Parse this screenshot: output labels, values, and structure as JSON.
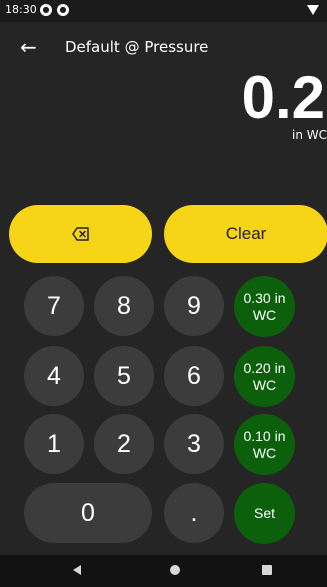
{
  "status_bar": {
    "time": "18:30",
    "app_icons": [
      "notification-icon",
      "notification-icon"
    ]
  },
  "header": {
    "title": "Default @ Pressure",
    "back_icon": "arrow-left-icon"
  },
  "display": {
    "value": "0.2",
    "unit": "in WC"
  },
  "actions": {
    "backspace_icon": "backspace-icon",
    "clear_label": "Clear"
  },
  "keypad": {
    "k7": "7",
    "k8": "8",
    "k9": "9",
    "k4": "4",
    "k5": "5",
    "k6": "6",
    "k1": "1",
    "k2": "2",
    "k3": "3",
    "k0": "0",
    "dot": "."
  },
  "presets": {
    "p1": "0.30 in WC",
    "p2": "0.20 in WC",
    "p3": "0.10 in WC",
    "set": "Set"
  },
  "nav_bar": {
    "back_icon": "triangle-back-icon",
    "home_icon": "circle-home-icon",
    "recents_icon": "square-recents-icon"
  },
  "colors": {
    "accent_yellow": "#f6d417",
    "preset_green": "#0c600c",
    "key_gray": "#3c3c3c",
    "background": "#252525"
  }
}
